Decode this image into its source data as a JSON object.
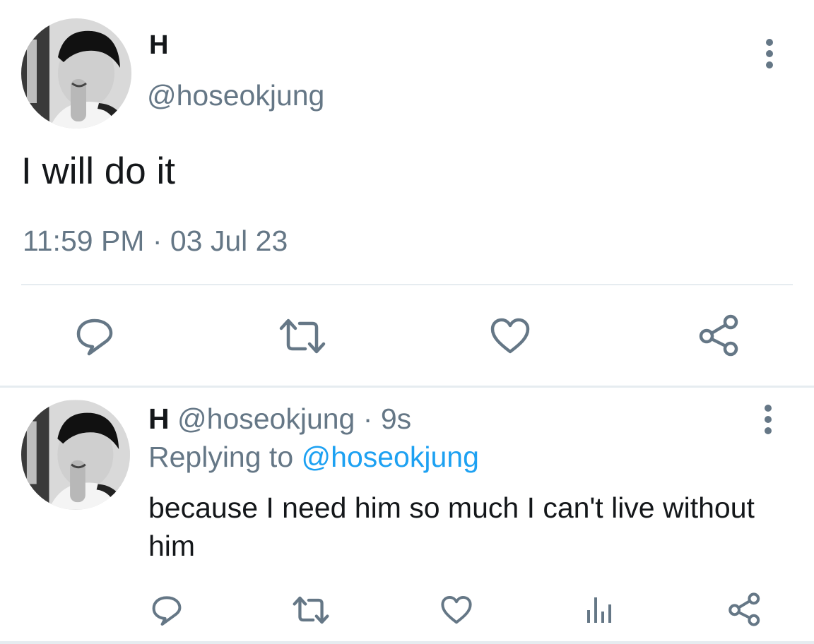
{
  "main_tweet": {
    "display_name": "H",
    "handle": "@hoseokjung",
    "text": "I will do it",
    "timestamp": "11:59 PM · 03 Jul 23",
    "avatar_icon": "profile-photo",
    "more_icon": "vertical-dots-icon",
    "actions": [
      "reply-icon",
      "retweet-icon",
      "like-icon",
      "share-icon"
    ]
  },
  "reply_tweet": {
    "display_name": "H",
    "handle": "@hoseokjung",
    "separator": "·",
    "age": "9s",
    "replying_label": "Replying to",
    "replying_mention": "@hoseokjung",
    "text": "because I need him so much I can't live without him",
    "avatar_icon": "profile-photo",
    "more_icon": "vertical-dots-icon",
    "actions": [
      "reply-icon",
      "retweet-icon",
      "like-icon",
      "analytics-icon",
      "share-icon"
    ]
  },
  "colors": {
    "primary_text": "#14171a",
    "secondary_text": "#657786",
    "link": "#1da1f2",
    "divider": "#e6ecf0"
  }
}
